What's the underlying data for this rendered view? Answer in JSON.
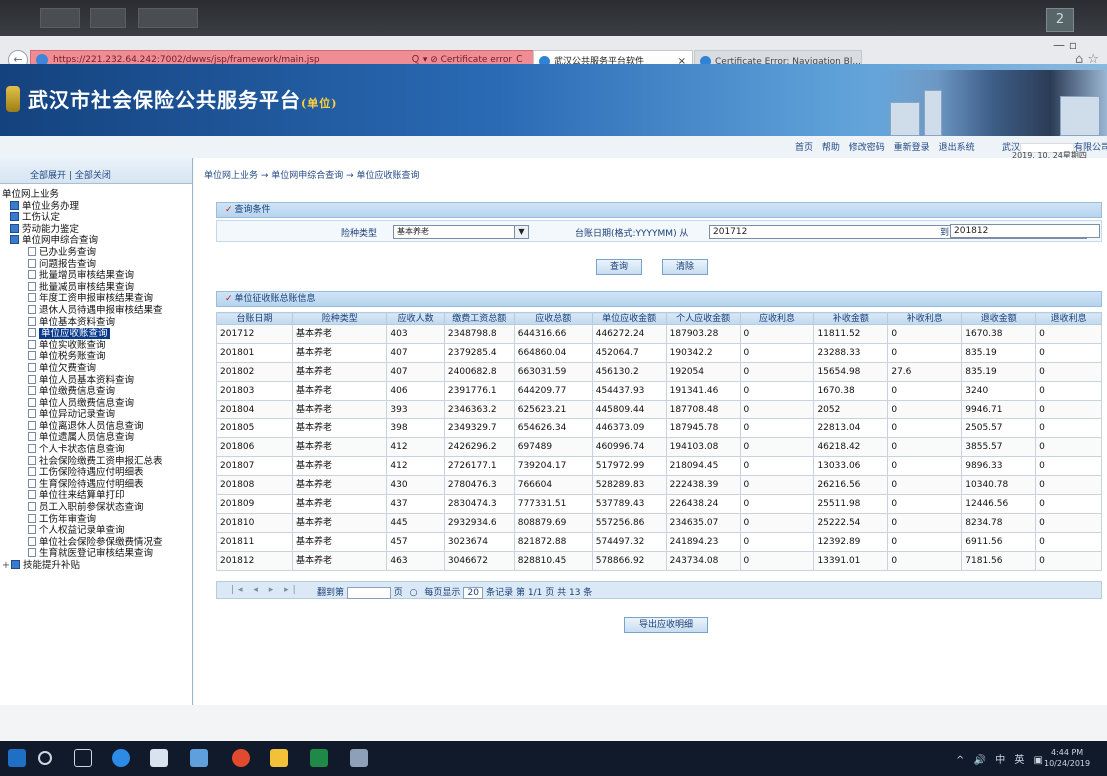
{
  "desktop": {
    "page_counter": "2"
  },
  "browser": {
    "url": "https://221.232.64.242:7002/dwws/jsp/framework/main.jsp",
    "url_tools": "Ｑ ▾ ⊘ Certificate error Ｃ",
    "tabs": [
      {
        "label": "武汉公共服务平台软件",
        "close": "×"
      },
      {
        "label": "Certificate Error: Navigation Bl..."
      }
    ],
    "window_controls": "—  ▫",
    "toolbar_icons": "⌂ ☆"
  },
  "header": {
    "title": "武汉市社会保险公共服务平台",
    "subtitle": "(单位)",
    "links": [
      "首页",
      "帮助",
      "修改密码",
      "重新登录",
      "退出系统"
    ],
    "user_prefix": "武汉",
    "user_suffix": "有限公司",
    "date": "2019. 10. 24星期四"
  },
  "left": {
    "expand_all": "全部展开",
    "separator": "|",
    "collapse_all": "全部关闭",
    "root": "单位网上业务",
    "groups": [
      {
        "label": "单位业务办理"
      },
      {
        "label": "工伤认定"
      },
      {
        "label": "劳动能力鉴定"
      },
      {
        "label": "单位网申综合查询"
      }
    ],
    "items": [
      "已办业务查询",
      "问题报告查询",
      "批量增员审核结果查询",
      "批量减员审核结果查询",
      "年度工资申报审核结果查询",
      "退休人员待遇申报审核结果查",
      "单位基本资料查询",
      "单位应收账查询",
      "单位实收账查询",
      "单位税务账查询",
      "单位欠费查询",
      "单位人员基本资料查询",
      "单位缴费信息查询",
      "单位人员缴费信息查询",
      "单位异动记录查询",
      "单位离退休人员信息查询",
      "单位遗属人员信息查询",
      "个人卡状态信息查询",
      "社会保险缴费工资申报汇总表",
      "工伤保险待遇应付明细表",
      "生育保险待遇应付明细表",
      "单位往来结算单打印",
      "员工入职前参保状态查询",
      "工伤年审查询",
      "个人权益记录单查询",
      "单位社会保险参保缴费情况查",
      "生育就医登记审核结果查询"
    ],
    "active_index": 7,
    "last_group": "技能提升补贴",
    "last_group_plus": "+"
  },
  "main": {
    "breadcrumb": "单位网上业务 → 单位网申综合查询 → 单位应收账查询",
    "query": {
      "section_title": "查询条件",
      "insurance_type_label": "险种类型",
      "insurance_type_value": "基本养老",
      "date_label": "台账日期(格式:YYYYMM) 从",
      "date_from": "201712",
      "date_to_label": "到",
      "date_to": "201812",
      "query_button": "查询",
      "clear_button": "清除"
    },
    "summary": {
      "section_title": "单位征收账总账信息",
      "columns": [
        "台账日期",
        "险种类型",
        "应收人数",
        "缴费工资总额",
        "应收总额",
        "单位应收金额",
        "个人应收金额",
        "应收利息",
        "补收金额",
        "补收利息",
        "退收金额",
        "退收利息"
      ],
      "rows": [
        [
          "201712",
          "基本养老",
          "403",
          "2348798.8",
          "644316.66",
          "446272.24",
          "187903.28",
          "0",
          "11811.52",
          "0",
          "1670.38",
          "0"
        ],
        [
          "201801",
          "基本养老",
          "407",
          "2379285.4",
          "664860.04",
          "452064.7",
          "190342.2",
          "0",
          "23288.33",
          "0",
          "835.19",
          "0"
        ],
        [
          "201802",
          "基本养老",
          "407",
          "2400682.8",
          "663031.59",
          "456130.2",
          "192054",
          "0",
          "15654.98",
          "27.6",
          "835.19",
          "0"
        ],
        [
          "201803",
          "基本养老",
          "406",
          "2391776.1",
          "644209.77",
          "454437.93",
          "191341.46",
          "0",
          "1670.38",
          "0",
          "3240",
          "0"
        ],
        [
          "201804",
          "基本养老",
          "393",
          "2346363.2",
          "625623.21",
          "445809.44",
          "187708.48",
          "0",
          "2052",
          "0",
          "9946.71",
          "0"
        ],
        [
          "201805",
          "基本养老",
          "398",
          "2349329.7",
          "654626.34",
          "446373.09",
          "187945.78",
          "0",
          "22813.04",
          "0",
          "2505.57",
          "0"
        ],
        [
          "201806",
          "基本养老",
          "412",
          "2426296.2",
          "697489",
          "460996.74",
          "194103.08",
          "0",
          "46218.42",
          "0",
          "3855.57",
          "0"
        ],
        [
          "201807",
          "基本养老",
          "412",
          "2726177.1",
          "739204.17",
          "517972.99",
          "218094.45",
          "0",
          "13033.06",
          "0",
          "9896.33",
          "0"
        ],
        [
          "201808",
          "基本养老",
          "430",
          "2780476.3",
          "766604",
          "528289.83",
          "222438.39",
          "0",
          "26216.56",
          "0",
          "10340.78",
          "0"
        ],
        [
          "201809",
          "基本养老",
          "437",
          "2830474.3",
          "777331.51",
          "537789.43",
          "226438.24",
          "0",
          "25511.98",
          "0",
          "12446.56",
          "0"
        ],
        [
          "201810",
          "基本养老",
          "445",
          "2932934.6",
          "808879.69",
          "557256.86",
          "234635.07",
          "0",
          "25222.54",
          "0",
          "8234.78",
          "0"
        ],
        [
          "201811",
          "基本养老",
          "457",
          "3023674",
          "821872.88",
          "574497.32",
          "241894.23",
          "0",
          "12392.89",
          "0",
          "6911.56",
          "0"
        ],
        [
          "201812",
          "基本养老",
          "463",
          "3046672",
          "828810.45",
          "578866.92",
          "243734.08",
          "0",
          "13391.01",
          "0",
          "7181.56",
          "0"
        ]
      ]
    },
    "pager": {
      "nav": "|◂ ◂ ▸ ▸|",
      "goto_label": "翻到第",
      "goto_suffix": "页",
      "refresh": "○",
      "per_page_label": "每页显示",
      "per_page": "20",
      "per_page_suffix": "条记录",
      "info": "第 1/1 页 共 13 条"
    },
    "export_button": "导出应收明细"
  },
  "taskbar": {
    "tray": "^ 🔊 中 英 ▣",
    "time": "4:44 PM",
    "date": "10/24/2019"
  }
}
